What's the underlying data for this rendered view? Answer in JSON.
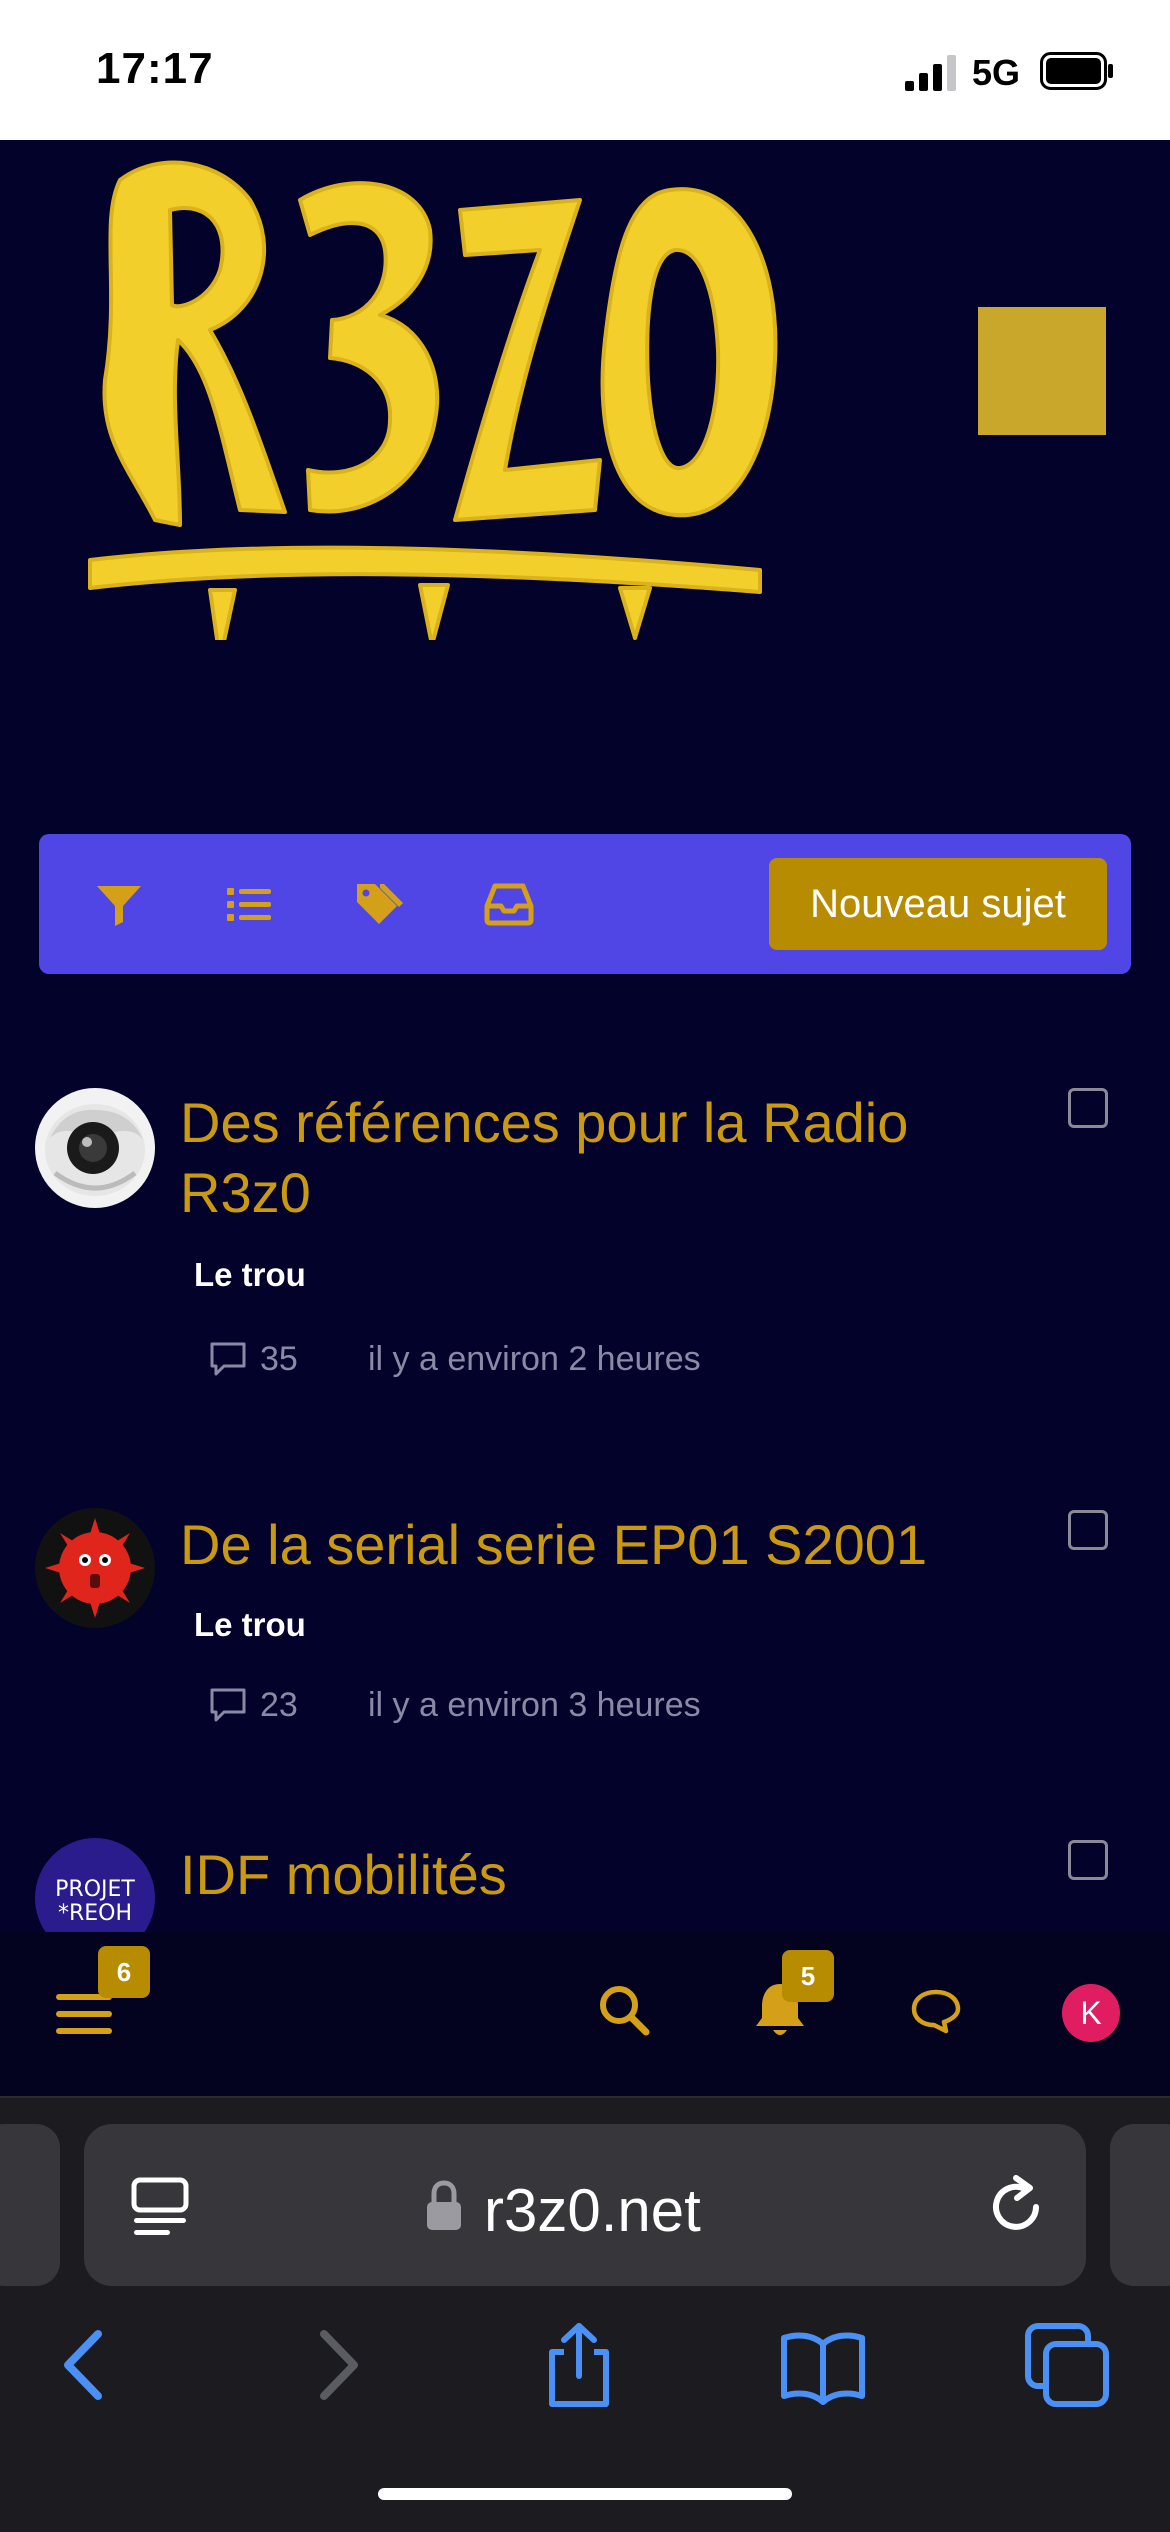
{
  "status_bar": {
    "time": "17:17",
    "network": "5G"
  },
  "header": {
    "logo_text": "R3Z0",
    "accent_color": "#c9a72a"
  },
  "toolbar": {
    "icons": [
      "filter-icon",
      "list-icon",
      "tags-icon",
      "inbox-icon"
    ],
    "new_topic_label": "Nouveau sujet"
  },
  "topics": [
    {
      "title_line1": "Des références pour la Radio",
      "title_line2": "R3z0",
      "category": "Le trou",
      "replies": "35",
      "time": "il y a environ 2 heures"
    },
    {
      "title_line1": "De la serial serie EP01 S2001",
      "title_line2": "",
      "category": "Le trou",
      "replies": "23",
      "time": "il y a environ 3 heures"
    },
    {
      "title_line1": "IDF mobilités",
      "title_line2": "",
      "avatar_text1": "PROJET",
      "avatar_text2": "*REOH"
    }
  ],
  "bottom_nav": {
    "menu_badge": "6",
    "notifications_badge": "5",
    "user_initial": "K"
  },
  "browser": {
    "url": "r3z0.net"
  },
  "colors": {
    "background": "#03022b",
    "toolbar": "#4f46e5",
    "accent": "#b88c00",
    "title": "#c99a10"
  }
}
